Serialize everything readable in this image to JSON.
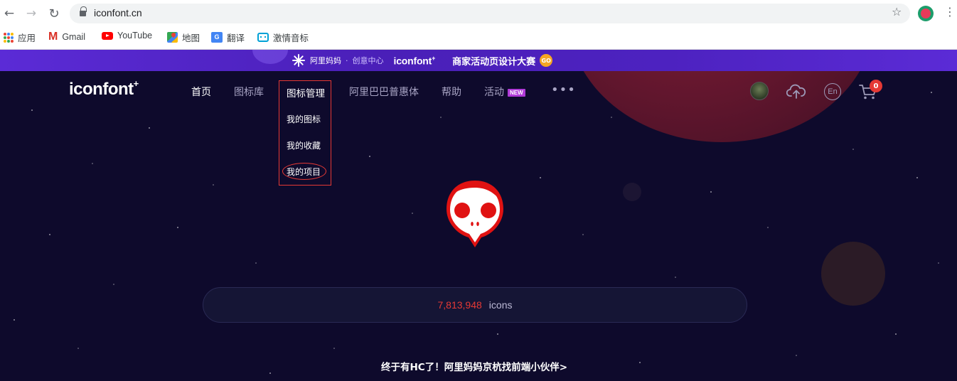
{
  "browser": {
    "url": "iconfont.cn",
    "bookmarks": [
      {
        "label": "应用",
        "icon": "apps-grid-icon"
      },
      {
        "label": "Gmail",
        "icon": "gmail-icon"
      },
      {
        "label": "YouTube",
        "icon": "youtube-icon"
      },
      {
        "label": "地图",
        "icon": "maps-icon"
      },
      {
        "label": "翻译",
        "icon": "translate-icon"
      },
      {
        "label": "激情音标",
        "icon": "bilibili-icon"
      }
    ]
  },
  "banner": {
    "alimama": "阿里妈妈",
    "dot": "·",
    "creative": "创意中心",
    "brand": "iconfont",
    "plus": "+",
    "contest": "商家活动页设计大赛",
    "go": "GO"
  },
  "header": {
    "logo": "iconfont",
    "logo_plus": "+",
    "nav": [
      {
        "label": "首页",
        "active": true
      },
      {
        "label": "图标库",
        "active": false
      },
      {
        "label": "图标管理",
        "active": true
      },
      {
        "label": "阿里巴巴普惠体",
        "active": false
      },
      {
        "label": "帮助",
        "active": false
      },
      {
        "label": "活动",
        "active": false,
        "badge": "NEW"
      }
    ],
    "more": "•••",
    "lang": "En",
    "cart_count": "0"
  },
  "dropdown": {
    "items": [
      "我的图标",
      "我的收藏",
      "我的项目"
    ]
  },
  "stats": {
    "count": "7,813,948",
    "unit": "icons"
  },
  "hiring": "终于有HC了！阿里妈妈京杭找前端小伙伴>",
  "colors": {
    "brand_purple": "#5b2bd6",
    "background": "#0e0a2c",
    "accent_red": "#e53935"
  }
}
